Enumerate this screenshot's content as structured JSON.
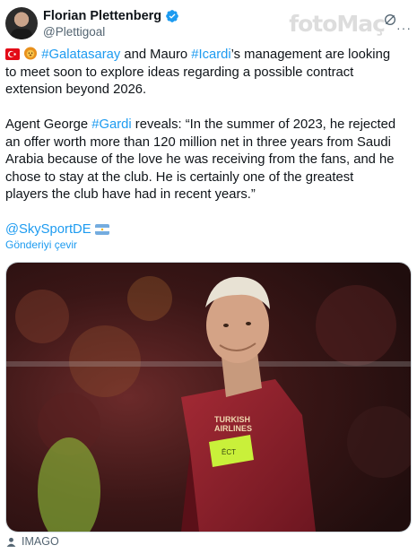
{
  "author": {
    "name": "Florian Plettenberg",
    "handle": "@Plettigoal"
  },
  "watermark": "fotoMaç",
  "tweet": {
    "line1_link1": "#Galatasaray",
    "line1_mid": " and Mauro ",
    "line1_link2": "#Icardi",
    "line1_rest": "’s management are looking to meet soon to explore ideas regarding a possible contract extension beyond 2026.",
    "p2_start": "Agent George ",
    "p2_link": "#Gardi",
    "p2_rest": " reveals: “In the summer of 2023, he rejected an offer worth more than 120 million net in three years from Saudi Arabia because of the love he was receiving from the fans, and he chose to stay at the club. He is certainly one of the greatest players the club have had in recent years.”",
    "mention": "@SkySportDE"
  },
  "translate_label": "Gönderiyi çevir",
  "media": {
    "sponsor_line1": "TURKISH",
    "sponsor_line2": "AIRLINES",
    "armband": "ĒCT"
  },
  "alt_label": "IMAGO",
  "colors": {
    "link": "#1d9bf0",
    "secondary_text": "#536471",
    "verified": "#1d9bf0",
    "jersey": "#8e1f2b",
    "armband": "#c9f03a"
  }
}
